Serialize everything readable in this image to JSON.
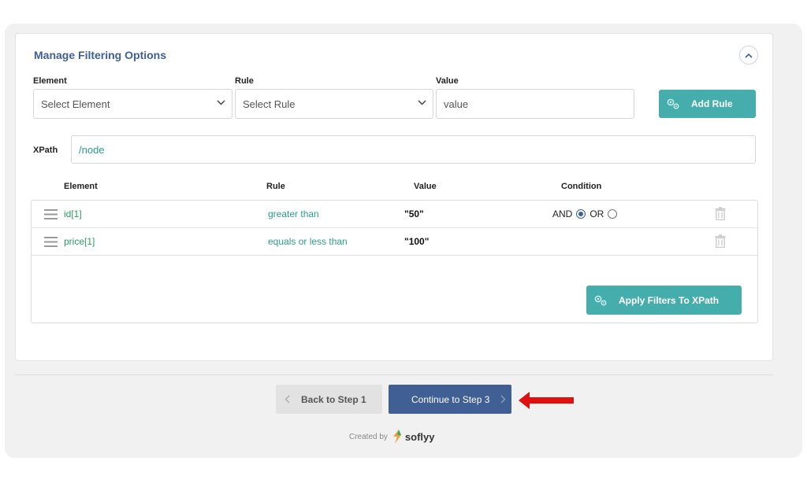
{
  "panel": {
    "title": "Manage Filtering Options"
  },
  "form": {
    "element_label": "Element",
    "element_placeholder": "Select Element",
    "rule_label": "Rule",
    "rule_placeholder": "Select Rule",
    "value_label": "Value",
    "value_placeholder": "value",
    "add_rule_label": "Add Rule",
    "xpath_label": "XPath",
    "xpath_value": "/node"
  },
  "table": {
    "headers": [
      "Element",
      "Rule",
      "Value",
      "Condition"
    ],
    "rows": [
      {
        "element": "id[1]",
        "rule": "greater than",
        "value": "\"50\"",
        "and_label": "AND",
        "or_label": "OR",
        "selected": "AND"
      },
      {
        "element": "price[1]",
        "rule": "equals or less than",
        "value": "\"100\""
      }
    ],
    "apply_label": "Apply Filters To XPath"
  },
  "nav": {
    "back_label": "Back to Step 1",
    "continue_label": "Continue to Step 3"
  },
  "footer": {
    "created_by": "Created by",
    "brand": "soflyy"
  },
  "colors": {
    "accent": "#3f5f95",
    "teal": "#45aead",
    "green_text": "#2a9d5f",
    "arrow": "#e01010"
  },
  "icons": [
    "chevron-up-icon",
    "chevron-down-icon",
    "gears-icon",
    "drag-handle-icon",
    "trash-icon",
    "chevron-left-icon",
    "chevron-right-icon",
    "red-arrow-icon",
    "soflyy-logo-icon"
  ]
}
